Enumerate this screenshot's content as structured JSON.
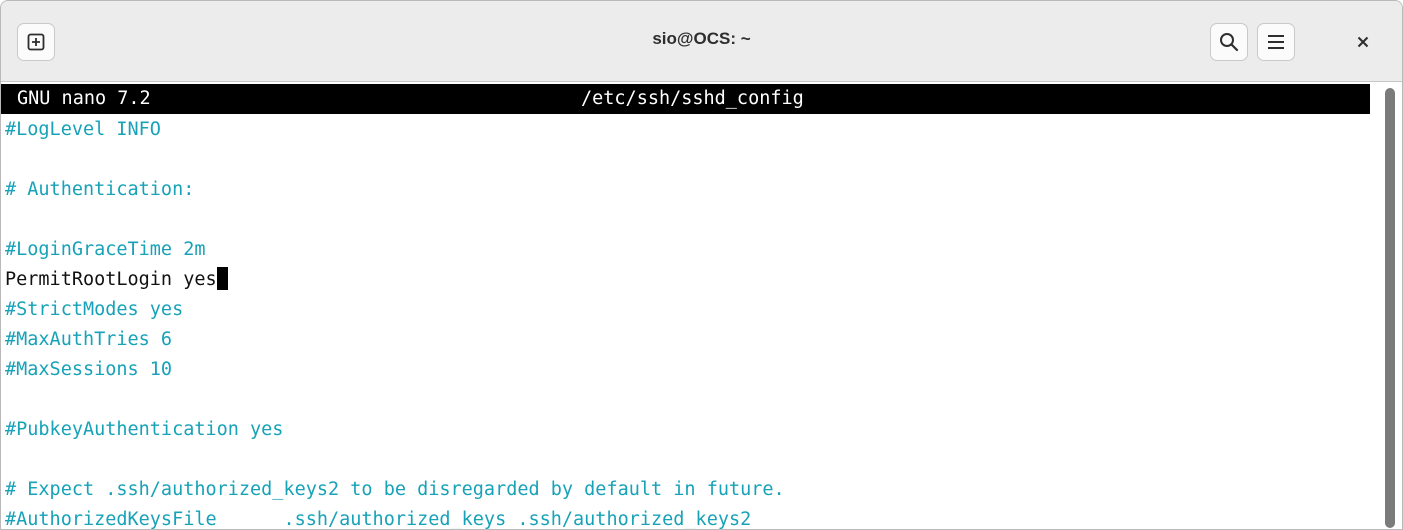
{
  "window": {
    "title": "sio@OCS: ~",
    "icons": {
      "new_tab": "new-tab-icon",
      "search": "search-icon",
      "menu": "hamburger-menu-icon",
      "close": "close-icon"
    }
  },
  "nano": {
    "app": "GNU nano 7.2",
    "filename": "/etc/ssh/sshd_config"
  },
  "lines": [
    {
      "text": "#LogLevel INFO",
      "type": "comment"
    },
    {
      "text": "",
      "type": "blank"
    },
    {
      "text": "# Authentication:",
      "type": "comment"
    },
    {
      "text": "",
      "type": "blank"
    },
    {
      "text": "#LoginGraceTime 2m",
      "type": "comment"
    },
    {
      "text": "PermitRootLogin yes",
      "type": "directive"
    },
    {
      "text": "#StrictModes yes",
      "type": "comment"
    },
    {
      "text": "#MaxAuthTries 6",
      "type": "comment"
    },
    {
      "text": "#MaxSessions 10",
      "type": "comment"
    },
    {
      "text": "",
      "type": "blank"
    },
    {
      "text": "#PubkeyAuthentication yes",
      "type": "comment"
    },
    {
      "text": "",
      "type": "blank"
    },
    {
      "text": "# Expect .ssh/authorized_keys2 to be disregarded by default in future.",
      "type": "comment"
    },
    {
      "text": "#AuthorizedKeysFile      .ssh/authorized_keys .ssh/authorized_keys2",
      "type": "comment"
    }
  ],
  "colors": {
    "comment": "#17a2b8",
    "text": "#111111",
    "header_bg": "#000000",
    "titlebar_bg": "#ececec"
  }
}
